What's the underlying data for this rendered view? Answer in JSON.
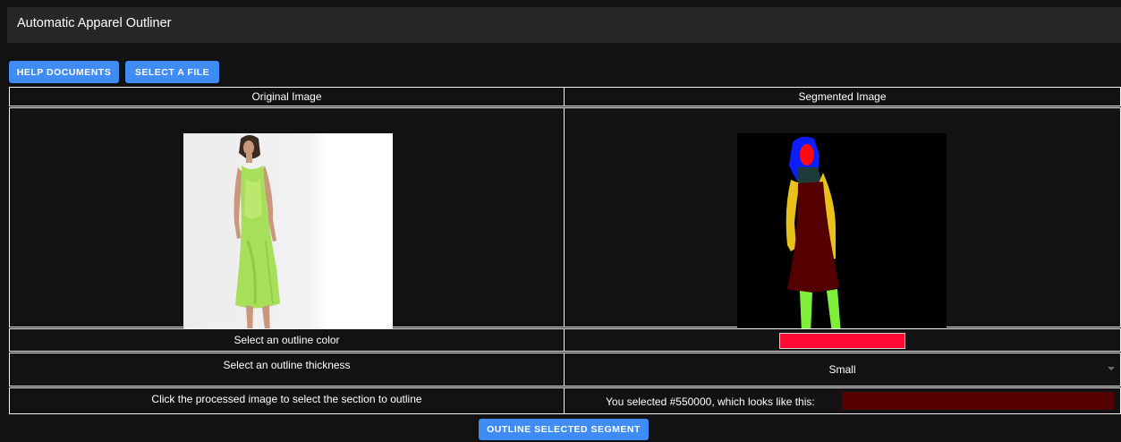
{
  "app": {
    "title": "Automatic Apparel Outliner"
  },
  "toolbar": {
    "help_label": "HELP DOCUMENTS",
    "select_file_label": "SELECT A FILE"
  },
  "table": {
    "original_header": "Original Image",
    "segmented_header": "Segmented Image",
    "outline_color_label": "Select an outline color",
    "outline_color_value": "#ff0a33",
    "outline_thickness_label": "Select an outline thickness",
    "outline_thickness_value": "Small",
    "click_instruction": "Click the processed image to select the section to outline",
    "selected_text": "You selected #550000, which looks like this:",
    "selected_color": "#550000"
  },
  "actions": {
    "outline_button_label": "OUTLINE SELECTED SEGMENT"
  },
  "colors": {
    "accent": "#3f8cf5",
    "background": "#121212",
    "titlebar": "#272727"
  }
}
